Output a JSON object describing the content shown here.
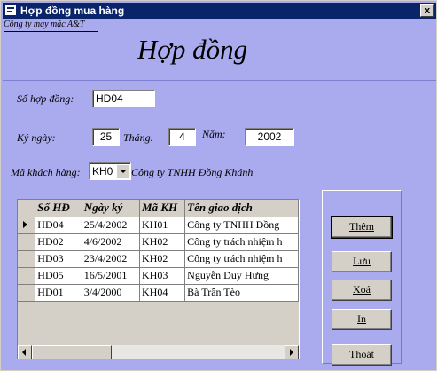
{
  "window": {
    "title": "Hợp đồng mua hàng",
    "close_label": "x"
  },
  "form": {
    "company": "Công ty may mặc A&T",
    "heading": "Hợp đồng",
    "contract_no_label": "Số hợp đồng:",
    "contract_no": "HD04",
    "date_label": "Ký ngày:",
    "day": "25",
    "month_label": "Tháng.",
    "month": "4",
    "year_label": "Năm:",
    "year": "2002",
    "customer_label": "Mã khách hàng:",
    "customer_code": "KH0",
    "customer_name": "Công ty TNHH Đồng Khánh"
  },
  "grid": {
    "columns": [
      "Số HĐ",
      "Ngày ký",
      "Mã KH",
      "Tên giao dịch"
    ],
    "rows": [
      [
        "HD04",
        "25/4/2002",
        "KH01",
        "Công ty TNHH Đồng"
      ],
      [
        "HD02",
        "4/6/2002",
        "KH02",
        "Công ty trách nhiệm h"
      ],
      [
        "HD03",
        "23/4/2002",
        "KH02",
        "Công ty trách nhiệm h"
      ],
      [
        "HD05",
        "16/5/2001",
        "KH03",
        "Nguyễn Duy Hưng"
      ],
      [
        "HD01",
        "3/4/2000",
        "KH04",
        "Bà Trần Tèo"
      ]
    ]
  },
  "buttons": {
    "add": "Thêm",
    "save": "Lưu",
    "delete": "Xoá",
    "print": "In",
    "exit": "Thoát"
  }
}
